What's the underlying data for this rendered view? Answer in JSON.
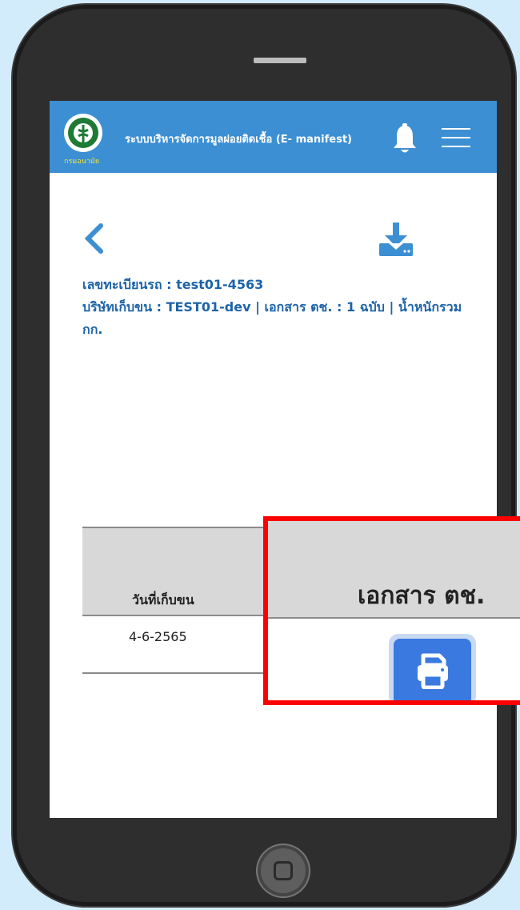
{
  "header": {
    "title": "ระบบบริหารจัดการมูลฝอยติดเชื้อ (E- manifest)",
    "logo_text": "กรมอนามัย"
  },
  "info": {
    "plate_line": "เลขทะเบียนรถ : test01-4563",
    "company_line": "บริษัทเก็บขน : TEST01-dev | เอกสาร ตช. : 1 ฉบับ | น้ำหนักรวม กก."
  },
  "table": {
    "columns": [
      "วันที่เก็บขน",
      "เอกสาร ตช."
    ],
    "rows": [
      {
        "date": "4-6-2565"
      }
    ]
  },
  "colors": {
    "header_bg": "#3c8fd3",
    "accent": "#3a7ae0",
    "highlight": "#ff0000",
    "text_blue": "#1d63a8"
  },
  "icons": [
    "logo-icon",
    "bell-icon",
    "menu-icon",
    "back-icon",
    "download-icon",
    "print-icon"
  ]
}
